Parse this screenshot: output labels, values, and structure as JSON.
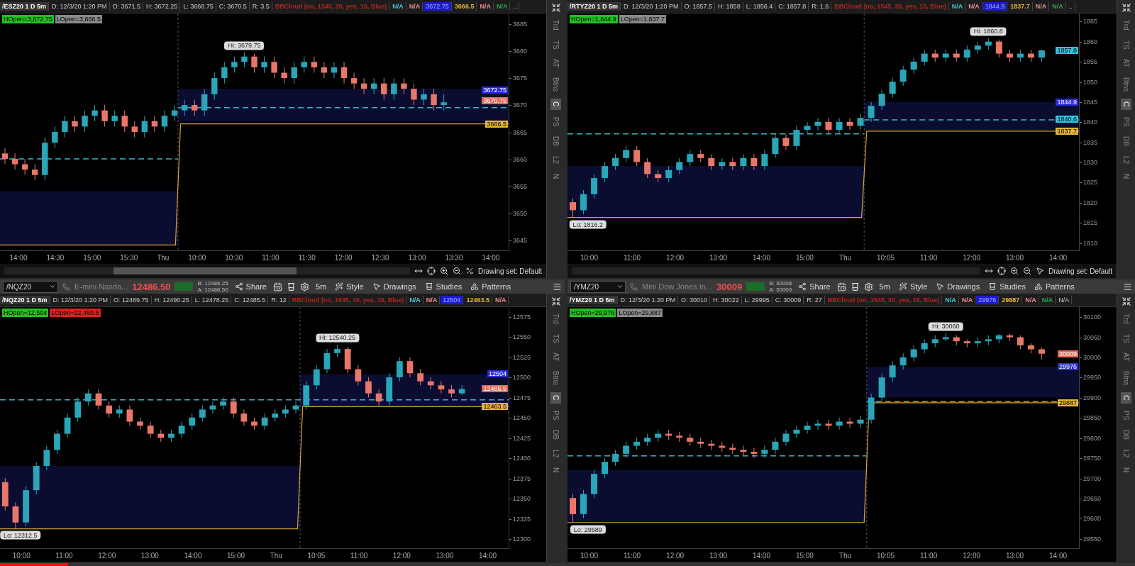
{
  "panels": [
    {
      "header": [
        {
          "kind": "title",
          "text": "/ESZ20 1 D 5m"
        },
        {
          "kind": "plain",
          "text": "D: 12/3/20 1:20 PM"
        },
        {
          "kind": "plain",
          "text": "O: 3671.5"
        },
        {
          "kind": "plain",
          "text": "H: 3672.25"
        },
        {
          "kind": "plain",
          "text": "L: 3668.75"
        },
        {
          "kind": "plain",
          "text": "C: 3670.5"
        },
        {
          "kind": "plain",
          "text": "R: 3.5"
        },
        {
          "kind": "colored",
          "color": "#b3261e",
          "text": "BBCloud (no, 1545, 30, yes, 15, Blue)"
        },
        {
          "kind": "colored",
          "color": "#3fc7d8",
          "text": "N/A"
        },
        {
          "kind": "colored",
          "color": "#f08a8a",
          "text": "N/A"
        },
        {
          "kind": "filled",
          "color": "#1a1ad0",
          "text": "3672.75"
        },
        {
          "kind": "colored",
          "color": "#e5b53a",
          "text": "3666.5"
        },
        {
          "kind": "colored",
          "color": "#f08a8a",
          "text": "N/A"
        },
        {
          "kind": "colored",
          "color": "#2fa84f",
          "text": "N/A"
        },
        {
          "kind": "plain",
          "text": ".."
        }
      ],
      "badges": [
        {
          "text": "HOpen=3,672.75",
          "color": "#22c022"
        },
        {
          "text": "LOpen=3,666.5",
          "color": "#8a8a8a"
        }
      ],
      "hi_label": "Hi: 3679.75",
      "price_tags": [
        {
          "text": "3672.75",
          "color": "#2a2ae0"
        },
        {
          "text": "3670.75",
          "color": "#e06a5a"
        },
        {
          "text": "3666.5",
          "color": "#e5b53a"
        }
      ],
      "chart_data": {
        "type": "candlestick",
        "ylim": [
          3643,
          3687
        ],
        "bands": [
          {
            "axis": "y",
            "from": 3644,
            "to": 3654
          },
          {
            "axis": "y",
            "from": 3667,
            "to": 3673
          }
        ],
        "ref_lines": [
          {
            "axis": "y",
            "value": 3660
          },
          {
            "axis": "y",
            "value": 3669.5
          }
        ],
        "yticks": [
          3685,
          3680,
          3675,
          3670,
          3665,
          3660,
          3655,
          3650,
          3645
        ],
        "categories": [
          null,
          null,
          null,
          null,
          null,
          null,
          null,
          null,
          null,
          null,
          null,
          null,
          null,
          null,
          null,
          null,
          null,
          null,
          null,
          null,
          null,
          null,
          null,
          null,
          null,
          null,
          null,
          null,
          null,
          null,
          null,
          null,
          null,
          null,
          null,
          null,
          null,
          null,
          null,
          null,
          null,
          null,
          null,
          null,
          null,
          null,
          null,
          null,
          null,
          null,
          null
        ],
        "ohlc": [
          [
            3661,
            3662,
            3659,
            3660
          ],
          [
            3660,
            3661,
            3658,
            3659
          ],
          [
            3659,
            3660,
            3657,
            3658
          ],
          [
            3658,
            3659,
            3656,
            3657
          ],
          [
            3657,
            3664,
            3656,
            3663
          ],
          [
            3663,
            3666,
            3662,
            3665
          ],
          [
            3665,
            3668,
            3664,
            3667
          ],
          [
            3667,
            3668,
            3665,
            3666
          ],
          [
            3666,
            3669,
            3665,
            3668
          ],
          [
            3668,
            3670,
            3667,
            3669
          ],
          [
            3669,
            3670,
            3666,
            3667
          ],
          [
            3667,
            3669,
            3666,
            3668
          ],
          [
            3668,
            3669,
            3665,
            3666
          ],
          [
            3666,
            3667,
            3664,
            3665
          ],
          [
            3665,
            3668,
            3664,
            3667
          ],
          [
            3667,
            3668,
            3665,
            3666
          ],
          [
            3666,
            3669,
            3665,
            3668
          ],
          [
            3668,
            3670,
            3667,
            3669
          ],
          [
            3669,
            3671,
            3668,
            3670
          ],
          [
            3670,
            3671,
            3668,
            3669
          ],
          [
            3669,
            3673,
            3668,
            3672
          ],
          [
            3672,
            3676,
            3671,
            3675
          ],
          [
            3675,
            3678,
            3674,
            3677
          ],
          [
            3677,
            3679,
            3676,
            3678
          ],
          [
            3678,
            3679.75,
            3677,
            3679
          ],
          [
            3679,
            3679.5,
            3676,
            3677
          ],
          [
            3677,
            3679,
            3676,
            3678
          ],
          [
            3678,
            3679,
            3675,
            3676
          ],
          [
            3676,
            3677,
            3674,
            3675
          ],
          [
            3675,
            3678,
            3674,
            3677
          ],
          [
            3677,
            3679,
            3676,
            3678
          ],
          [
            3678,
            3679,
            3676,
            3677
          ],
          [
            3677,
            3678,
            3675,
            3676
          ],
          [
            3676,
            3678,
            3675,
            3677
          ],
          [
            3677,
            3678,
            3674,
            3675
          ],
          [
            3675,
            3676,
            3673,
            3674
          ],
          [
            3674,
            3675,
            3672,
            3673
          ],
          [
            3673,
            3675,
            3672,
            3674
          ],
          [
            3674,
            3675,
            3671,
            3672
          ],
          [
            3672,
            3675,
            3671,
            3674
          ],
          [
            3674,
            3675,
            3672,
            3673
          ],
          [
            3673,
            3674,
            3670,
            3671
          ],
          [
            3671,
            3673,
            3670,
            3672
          ],
          [
            3672,
            3673,
            3669,
            3670
          ],
          [
            3670,
            3672,
            3669,
            3670.5
          ],
          null,
          null,
          null,
          null,
          null,
          null
        ]
      },
      "time_ticks": [
        "14:00",
        "14:30",
        "15:00",
        "15:30",
        "Thu",
        "10:00",
        "10:30",
        "11:00",
        "11:30",
        "12:00",
        "12:30",
        "13:00",
        "13:30",
        "14:00"
      ],
      "footer": {
        "scroll_thumb": true,
        "drawing_set": "Drawing set: Default",
        "cursor_tool": false
      },
      "side_tabs": [
        {
          "label": "Trd",
          "selected": false
        },
        {
          "label": "TS",
          "selected": false
        },
        {
          "label": "AT",
          "selected": false
        },
        {
          "label": "Btns",
          "selected": false
        },
        {
          "label": "C",
          "selected": true
        },
        {
          "label": "PS",
          "selected": false
        },
        {
          "label": "DB",
          "selected": false
        },
        {
          "label": "L2",
          "selected": false
        },
        {
          "label": "N",
          "selected": false
        }
      ]
    },
    {
      "header": [
        {
          "kind": "title",
          "text": "/RTYZ20 1 D 5m"
        },
        {
          "kind": "plain",
          "text": "D: 12/3/20 1:20 PM"
        },
        {
          "kind": "plain",
          "text": "O: 1857.5"
        },
        {
          "kind": "plain",
          "text": "H: 1858"
        },
        {
          "kind": "plain",
          "text": "L: 1856.4"
        },
        {
          "kind": "plain",
          "text": "C: 1857.8"
        },
        {
          "kind": "plain",
          "text": "R: 1.6"
        },
        {
          "kind": "colored",
          "color": "#b3261e",
          "text": "BBCloud (no, 1545, 30, yes, 15, Blue)"
        },
        {
          "kind": "colored",
          "color": "#3fc7d8",
          "text": "N/A"
        },
        {
          "kind": "colored",
          "color": "#f08a8a",
          "text": "N/A"
        },
        {
          "kind": "filled",
          "color": "#1a1ad0",
          "text": "1844.9"
        },
        {
          "kind": "colored",
          "color": "#e5b53a",
          "text": "1837.7"
        },
        {
          "kind": "colored",
          "color": "#f08a8a",
          "text": "N/A"
        },
        {
          "kind": "colored",
          "color": "#2fa84f",
          "text": "N/A"
        },
        {
          "kind": "plain",
          "text": ".."
        }
      ],
      "badges": [
        {
          "text": "HOpen=1,844.9",
          "color": "#22c022"
        },
        {
          "text": "LOpen=1,837.7",
          "color": "#8a8a8a"
        }
      ],
      "hi_label": "Hi: 1860.8",
      "lo_label": "Lo: 1816.2",
      "price_tags": [
        {
          "text": "1857.8",
          "color": "#2ec6e0"
        },
        {
          "text": "1844.9",
          "color": "#2a2ae0"
        },
        {
          "text": "1840.6",
          "color": "#2ec6e0"
        },
        {
          "text": "1837.7",
          "color": "#e5b53a"
        }
      ],
      "chart_data": {
        "type": "candlestick",
        "ylim": [
          1808,
          1867
        ],
        "bands": [
          {
            "axis": "y",
            "from": 1816,
            "to": 1829
          },
          {
            "axis": "y",
            "from": 1838,
            "to": 1845
          }
        ],
        "ref_lines": [
          {
            "axis": "y",
            "value": 1837
          },
          {
            "axis": "y",
            "value": 1840.5
          }
        ],
        "yticks": [
          1865,
          1860,
          1855,
          1850,
          1845,
          1840,
          1835,
          1830,
          1825,
          1820,
          1815,
          1810
        ],
        "categories": [
          null,
          null,
          null,
          null,
          null,
          null,
          null,
          null,
          null,
          null,
          null,
          null,
          null,
          null,
          null,
          null,
          null,
          null,
          null,
          null,
          null,
          null,
          null,
          null,
          null,
          null,
          null,
          null,
          null,
          null,
          null,
          null,
          null,
          null,
          null,
          null,
          null,
          null,
          null,
          null,
          null,
          null,
          null,
          null,
          null,
          null,
          null,
          null
        ],
        "ohlc": [
          [
            1820,
            1821,
            1816.2,
            1818
          ],
          [
            1818,
            1823,
            1817,
            1822
          ],
          [
            1822,
            1827,
            1821,
            1826
          ],
          [
            1826,
            1830,
            1825,
            1829
          ],
          [
            1829,
            1832,
            1828,
            1831
          ],
          [
            1831,
            1834,
            1830,
            1833
          ],
          [
            1833,
            1834,
            1829,
            1830
          ],
          [
            1830,
            1831,
            1826,
            1827
          ],
          [
            1827,
            1828,
            1825,
            1826
          ],
          [
            1826,
            1829,
            1825,
            1828
          ],
          [
            1828,
            1831,
            1827,
            1830
          ],
          [
            1830,
            1833,
            1829,
            1832
          ],
          [
            1832,
            1833,
            1830,
            1831
          ],
          [
            1831,
            1832,
            1828,
            1829
          ],
          [
            1829,
            1831,
            1828,
            1830
          ],
          [
            1830,
            1831,
            1828,
            1829
          ],
          [
            1829,
            1832,
            1828,
            1831
          ],
          [
            1831,
            1832,
            1828,
            1829
          ],
          [
            1829,
            1833,
            1828,
            1832
          ],
          [
            1832,
            1837,
            1831,
            1836
          ],
          [
            1836,
            1837,
            1833,
            1834
          ],
          [
            1834,
            1839,
            1833,
            1838
          ],
          [
            1838,
            1840,
            1837,
            1839
          ],
          [
            1839,
            1841,
            1838,
            1840
          ],
          [
            1840,
            1841,
            1837,
            1838
          ],
          [
            1838,
            1841,
            1837,
            1840
          ],
          [
            1840,
            1841,
            1838,
            1839
          ],
          [
            1839,
            1842,
            1838,
            1841
          ],
          [
            1841,
            1845,
            1840,
            1844
          ],
          [
            1844,
            1848,
            1843,
            1847
          ],
          [
            1847,
            1851,
            1846,
            1850
          ],
          [
            1850,
            1854,
            1849,
            1853
          ],
          [
            1853,
            1856,
            1852,
            1855
          ],
          [
            1855,
            1858,
            1854,
            1857
          ],
          [
            1857,
            1858,
            1855,
            1856
          ],
          [
            1856,
            1858,
            1855,
            1857
          ],
          [
            1857,
            1858,
            1855,
            1856
          ],
          [
            1856,
            1859,
            1855,
            1858
          ],
          [
            1858,
            1860,
            1857,
            1859
          ],
          [
            1859,
            1860.8,
            1858,
            1860
          ],
          [
            1860,
            1860.5,
            1856,
            1857
          ],
          [
            1857,
            1858,
            1855,
            1856
          ],
          [
            1856,
            1858,
            1855,
            1857
          ],
          [
            1857,
            1858,
            1855,
            1856
          ],
          [
            1856,
            1858,
            1855,
            1857.8
          ],
          null,
          null,
          null
        ]
      },
      "time_ticks": [
        "10:00",
        "11:00",
        "12:00",
        "13:00",
        "14:00",
        "15:00",
        "Thu",
        "10:05",
        "11:00",
        "12:00",
        "13:00",
        "14:00"
      ],
      "footer": {
        "scroll_thumb": false,
        "drawing_set": "Drawing set: Default",
        "cursor_tool": true
      },
      "side_tabs": [
        {
          "label": "Trd",
          "selected": false
        },
        {
          "label": "TS",
          "selected": false
        },
        {
          "label": "AT",
          "selected": false
        },
        {
          "label": "Btns",
          "selected": false
        },
        {
          "label": "C",
          "selected": true
        },
        {
          "label": "PS",
          "selected": false
        },
        {
          "label": "DB",
          "selected": false
        },
        {
          "label": "L2",
          "selected": false
        },
        {
          "label": "N",
          "selected": false
        }
      ]
    },
    {
      "toolbar": {
        "symbol": "/NQZ20",
        "description": "E-mini Nasda...",
        "last": "12486.50",
        "bid": "B: 12486.25",
        "ask": "A: 12486.50",
        "interval": "5m",
        "buttons": [
          {
            "kind": "share",
            "label": "Share"
          },
          {
            "kind": "style",
            "label": "Style"
          },
          {
            "kind": "drawings",
            "label": "Drawings"
          },
          {
            "kind": "studies",
            "label": "Studies"
          },
          {
            "kind": "patterns",
            "label": "Patterns"
          }
        ]
      },
      "header": [
        {
          "kind": "title",
          "text": "/NQZ20 1 D 5m"
        },
        {
          "kind": "plain",
          "text": "D: 12/3/20 1:20 PM"
        },
        {
          "kind": "plain",
          "text": "O: 12489.75"
        },
        {
          "kind": "plain",
          "text": "H: 12490.25"
        },
        {
          "kind": "plain",
          "text": "L: 12478.25"
        },
        {
          "kind": "plain",
          "text": "C: 12485.5"
        },
        {
          "kind": "plain",
          "text": "R: 12"
        },
        {
          "kind": "colored",
          "color": "#b3261e",
          "text": "BBCloud (no, 1545, 30, yes, 15, Blue)"
        },
        {
          "kind": "colored",
          "color": "#3fc7d8",
          "text": "N/A"
        },
        {
          "kind": "colored",
          "color": "#f08a8a",
          "text": "N/A"
        },
        {
          "kind": "filled",
          "color": "#1a1ad0",
          "text": "12504"
        },
        {
          "kind": "colored",
          "color": "#e5b53a",
          "text": "12463.5"
        },
        {
          "kind": "colored",
          "color": "#f08a8a",
          "text": "N/A"
        }
      ],
      "badges": [
        {
          "text": "HOpen=12,504",
          "color": "#22c022"
        },
        {
          "text": "LOpen=12,460.5",
          "color": "#e02020"
        }
      ],
      "hi_label": "Hi: 12540.25",
      "lo_label": "Lo: 12312.5",
      "price_tags": [
        {
          "text": "12504",
          "color": "#2a2ae0"
        },
        {
          "text": "12485.5",
          "color": "#e06a5a"
        },
        {
          "text": "12463.5",
          "color": "#e5b53a"
        }
      ],
      "chart_data": {
        "type": "candlestick",
        "ylim": [
          12288,
          12587
        ],
        "bands": [
          {
            "axis": "y",
            "from": 12312,
            "to": 12390
          },
          {
            "axis": "y",
            "from": 12463,
            "to": 12504
          }
        ],
        "ref_lines": [
          {
            "axis": "y",
            "value": 12472
          }
        ],
        "yticks": [
          12575,
          12550,
          12525,
          12500,
          12475,
          12450,
          12425,
          12400,
          12375,
          12350,
          12325,
          12300
        ],
        "categories": [
          null,
          null,
          null,
          null,
          null,
          null,
          null,
          null,
          null,
          null,
          null,
          null,
          null,
          null,
          null,
          null,
          null,
          null,
          null,
          null,
          null,
          null,
          null,
          null,
          null,
          null,
          null,
          null,
          null,
          null,
          null,
          null,
          null,
          null,
          null,
          null,
          null,
          null,
          null,
          null,
          null,
          null,
          null,
          null,
          null,
          null,
          null,
          null,
          null
        ],
        "ohlc": [
          [
            12370,
            12375,
            12335,
            12340
          ],
          [
            12340,
            12345,
            12312.5,
            12320
          ],
          [
            12320,
            12365,
            12315,
            12360
          ],
          [
            12360,
            12395,
            12355,
            12390
          ],
          [
            12390,
            12415,
            12385,
            12410
          ],
          [
            12410,
            12435,
            12405,
            12430
          ],
          [
            12430,
            12455,
            12425,
            12450
          ],
          [
            12450,
            12475,
            12445,
            12470
          ],
          [
            12470,
            12485,
            12465,
            12480
          ],
          [
            12480,
            12485,
            12460,
            12465
          ],
          [
            12465,
            12470,
            12450,
            12455
          ],
          [
            12455,
            12465,
            12450,
            12460
          ],
          [
            12460,
            12465,
            12440,
            12445
          ],
          [
            12445,
            12450,
            12435,
            12440
          ],
          [
            12440,
            12445,
            12425,
            12430
          ],
          [
            12430,
            12435,
            12420,
            12425
          ],
          [
            12425,
            12435,
            12420,
            12430
          ],
          [
            12430,
            12445,
            12425,
            12440
          ],
          [
            12440,
            12455,
            12435,
            12450
          ],
          [
            12450,
            12465,
            12445,
            12460
          ],
          [
            12460,
            12470,
            12455,
            12465
          ],
          [
            12465,
            12475,
            12460,
            12470
          ],
          [
            12470,
            12475,
            12450,
            12455
          ],
          [
            12455,
            12460,
            12440,
            12445
          ],
          [
            12445,
            12450,
            12435,
            12440
          ],
          [
            12440,
            12455,
            12435,
            12450
          ],
          [
            12450,
            12460,
            12445,
            12455
          ],
          [
            12455,
            12465,
            12450,
            12460
          ],
          [
            12460,
            12470,
            12455,
            12465
          ],
          [
            12465,
            12495,
            12460,
            12490
          ],
          [
            12490,
            12515,
            12485,
            12510
          ],
          [
            12510,
            12535,
            12505,
            12530
          ],
          [
            12530,
            12540.25,
            12525,
            12535
          ],
          [
            12535,
            12538,
            12505,
            12510
          ],
          [
            12510,
            12515,
            12490,
            12495
          ],
          [
            12495,
            12500,
            12475,
            12480
          ],
          [
            12480,
            12485,
            12465,
            12470
          ],
          [
            12470,
            12505,
            12465,
            12500
          ],
          [
            12500,
            12525,
            12495,
            12520
          ],
          [
            12520,
            12525,
            12500,
            12505
          ],
          [
            12505,
            12510,
            12490,
            12495
          ],
          [
            12495,
            12500,
            12485,
            12490
          ],
          [
            12490,
            12495,
            12480,
            12485
          ],
          [
            12485,
            12490,
            12475,
            12480
          ],
          [
            12480,
            12490,
            12478,
            12485.5
          ],
          null,
          null,
          null,
          null
        ]
      },
      "time_ticks": [
        "10:00",
        "11:00",
        "12:00",
        "13:00",
        "14:00",
        "15:00",
        "Thu",
        "10:05",
        "11:00",
        "12:00",
        "13:00",
        "14:00"
      ],
      "side_tabs": [
        {
          "label": "Trd",
          "selected": false
        },
        {
          "label": "TS",
          "selected": false
        },
        {
          "label": "AT",
          "selected": false
        },
        {
          "label": "Btns",
          "selected": false
        },
        {
          "label": "C",
          "selected": true
        },
        {
          "label": "PS",
          "selected": false
        },
        {
          "label": "DB",
          "selected": false
        },
        {
          "label": "L2",
          "selected": false
        },
        {
          "label": "N",
          "selected": false
        }
      ]
    },
    {
      "toolbar": {
        "symbol": "/YMZ20",
        "description": "Mini Dow Jones In...",
        "last": "30009",
        "bid": "B: 30008",
        "ask": "A: 30009",
        "interval": "5m",
        "buttons": [
          {
            "kind": "share",
            "label": "Share"
          },
          {
            "kind": "style",
            "label": "Style"
          },
          {
            "kind": "drawings",
            "label": "Drawings"
          },
          {
            "kind": "studies",
            "label": "Studies"
          },
          {
            "kind": "patterns",
            "label": "Patterns"
          }
        ]
      },
      "header": [
        {
          "kind": "title",
          "text": "/YMZ20 1 D 5m"
        },
        {
          "kind": "plain",
          "text": "D: 12/3/20 1:20 PM"
        },
        {
          "kind": "plain",
          "text": "O: 30010"
        },
        {
          "kind": "plain",
          "text": "H: 30022"
        },
        {
          "kind": "plain",
          "text": "L: 29995"
        },
        {
          "kind": "plain",
          "text": "C: 30009"
        },
        {
          "kind": "plain",
          "text": "R: 27"
        },
        {
          "kind": "colored",
          "color": "#b3261e",
          "text": "BBCloud (no, 1545, 30, yes, 15, Blue)"
        },
        {
          "kind": "colored",
          "color": "#3fc7d8",
          "text": "N/A"
        },
        {
          "kind": "colored",
          "color": "#f08a8a",
          "text": "N/A"
        },
        {
          "kind": "filled",
          "color": "#1a1ad0",
          "text": "29976"
        },
        {
          "kind": "colored",
          "color": "#e5b53a",
          "text": "29887"
        },
        {
          "kind": "colored",
          "color": "#f08a8a",
          "text": "N/A"
        },
        {
          "kind": "colored",
          "color": "#2fa84f",
          "text": "N/A"
        },
        {
          "kind": "plain",
          "text": "N/A"
        }
      ],
      "badges": [
        {
          "text": "HOpen=29,976",
          "color": "#22c022"
        },
        {
          "text": "LOpen=29,887",
          "color": "#8a8a8a"
        }
      ],
      "hi_label": "Hi: 30060",
      "lo_label": "Lo: 29589",
      "price_tags": [
        {
          "text": "30009",
          "color": "#e06a5a"
        },
        {
          "text": "29976",
          "color": "#2a2ae0"
        },
        {
          "text": "29887",
          "color": "#e5b53a"
        }
      ],
      "chart_data": {
        "type": "candlestick",
        "ylim": [
          29525,
          30125
        ],
        "bands": [
          {
            "axis": "y",
            "from": 29590,
            "to": 29720
          },
          {
            "axis": "y",
            "from": 29900,
            "to": 29976
          }
        ],
        "ref_lines": [
          {
            "axis": "y",
            "value": 29755
          },
          {
            "axis": "y",
            "value": 29890
          }
        ],
        "yticks": [
          30100,
          30050,
          30000,
          29950,
          29900,
          29850,
          29800,
          29750,
          29700,
          29650,
          29600,
          29550
        ],
        "categories": [
          null,
          null,
          null,
          null,
          null,
          null,
          null,
          null,
          null,
          null,
          null,
          null,
          null,
          null,
          null,
          null,
          null,
          null,
          null,
          null,
          null,
          null,
          null,
          null,
          null,
          null,
          null,
          null,
          null,
          null,
          null,
          null,
          null,
          null,
          null,
          null,
          null,
          null,
          null,
          null,
          null,
          null,
          null,
          null,
          null,
          null,
          null,
          null
        ],
        "ohlc": [
          [
            29650,
            29660,
            29589,
            29610
          ],
          [
            29610,
            29670,
            29600,
            29660
          ],
          [
            29660,
            29720,
            29650,
            29710
          ],
          [
            29710,
            29750,
            29700,
            29740
          ],
          [
            29740,
            29770,
            29730,
            29760
          ],
          [
            29760,
            29790,
            29750,
            29780
          ],
          [
            29780,
            29800,
            29770,
            29790
          ],
          [
            29790,
            29810,
            29780,
            29800
          ],
          [
            29800,
            29820,
            29790,
            29810
          ],
          [
            29810,
            29820,
            29795,
            29805
          ],
          [
            29805,
            29815,
            29790,
            29800
          ],
          [
            29800,
            29810,
            29780,
            29790
          ],
          [
            29790,
            29800,
            29775,
            29785
          ],
          [
            29785,
            29795,
            29770,
            29780
          ],
          [
            29780,
            29790,
            29765,
            29775
          ],
          [
            29775,
            29785,
            29760,
            29770
          ],
          [
            29770,
            29780,
            29755,
            29765
          ],
          [
            29765,
            29775,
            29750,
            29760
          ],
          [
            29760,
            29780,
            29750,
            29770
          ],
          [
            29770,
            29800,
            29760,
            29790
          ],
          [
            29790,
            29820,
            29780,
            29810
          ],
          [
            29810,
            29830,
            29800,
            29820
          ],
          [
            29820,
            29840,
            29810,
            29830
          ],
          [
            29830,
            29845,
            29820,
            29835
          ],
          [
            29835,
            29845,
            29820,
            29830
          ],
          [
            29830,
            29850,
            29820,
            29840
          ],
          [
            29840,
            29850,
            29825,
            29835
          ],
          [
            29835,
            29855,
            29825,
            29845
          ],
          [
            29845,
            29910,
            29835,
            29900
          ],
          [
            29900,
            29960,
            29890,
            29950
          ],
          [
            29950,
            29990,
            29940,
            29980
          ],
          [
            29980,
            30010,
            29970,
            30000
          ],
          [
            30000,
            30030,
            29990,
            30020
          ],
          [
            30020,
            30045,
            30010,
            30035
          ],
          [
            30035,
            30055,
            30025,
            30045
          ],
          [
            30045,
            30060,
            30040,
            30050
          ],
          [
            30050,
            30055,
            30030,
            30040
          ],
          [
            30040,
            30045,
            30025,
            30035
          ],
          [
            30035,
            30050,
            30025,
            30040
          ],
          [
            30040,
            30055,
            30030,
            30045
          ],
          [
            30045,
            30058,
            30035,
            30055
          ],
          [
            30055,
            30058,
            30040,
            30050
          ],
          [
            30050,
            30055,
            30020,
            30030
          ],
          [
            30030,
            30035,
            30010,
            30020
          ],
          [
            30020,
            30025,
            29995,
            30009
          ],
          null,
          null,
          null
        ]
      },
      "time_ticks": [
        "10:00",
        "11:00",
        "12:00",
        "13:00",
        "14:00",
        "15:00",
        "Thu",
        "10:05",
        "11:00",
        "12:00",
        "13:00",
        "14:00"
      ],
      "side_tabs": [
        {
          "label": "Trd",
          "selected": false
        },
        {
          "label": "TS",
          "selected": false
        },
        {
          "label": "AT",
          "selected": false
        },
        {
          "label": "Btns",
          "selected": false
        },
        {
          "label": "C",
          "selected": true
        },
        {
          "label": "PS",
          "selected": false
        },
        {
          "label": "DB",
          "selected": false
        },
        {
          "label": "L2",
          "selected": false
        },
        {
          "label": "N",
          "selected": false
        }
      ]
    }
  ],
  "playback": {
    "level": 0.06
  }
}
